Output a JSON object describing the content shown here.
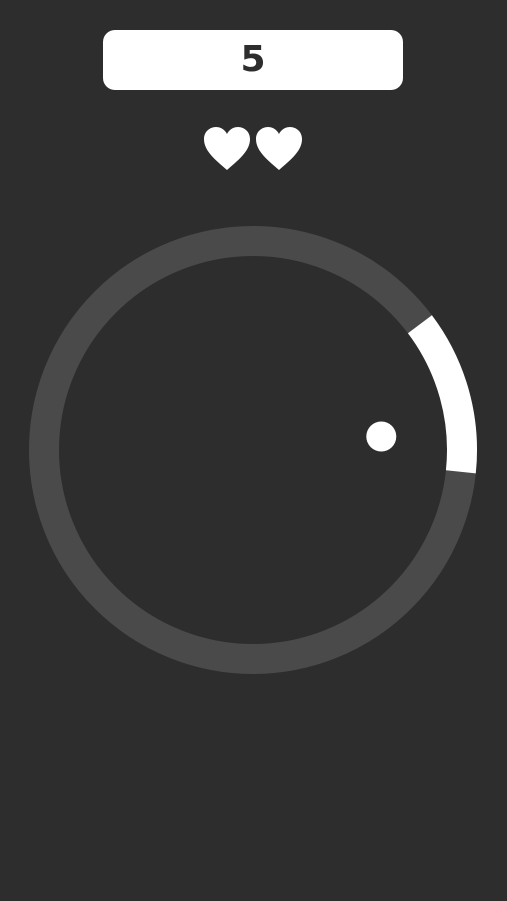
{
  "hud": {
    "score": "5",
    "lives": [
      {
        "icon": "heart-icon"
      },
      {
        "icon": "heart-icon"
      }
    ]
  },
  "game": {
    "target_zone": {
      "start_angle_deg": -37,
      "end_angle_deg": 6
    },
    "ball": {
      "angle_deg": -6
    }
  },
  "colors": {
    "background": "#2d2d2d",
    "ring": "#4a4a4a",
    "target_zone": "#ffffff",
    "ball": "#ffffff",
    "score_box": "#ffffff",
    "score_text": "#2d2d2d",
    "heart": "#ffffff"
  }
}
